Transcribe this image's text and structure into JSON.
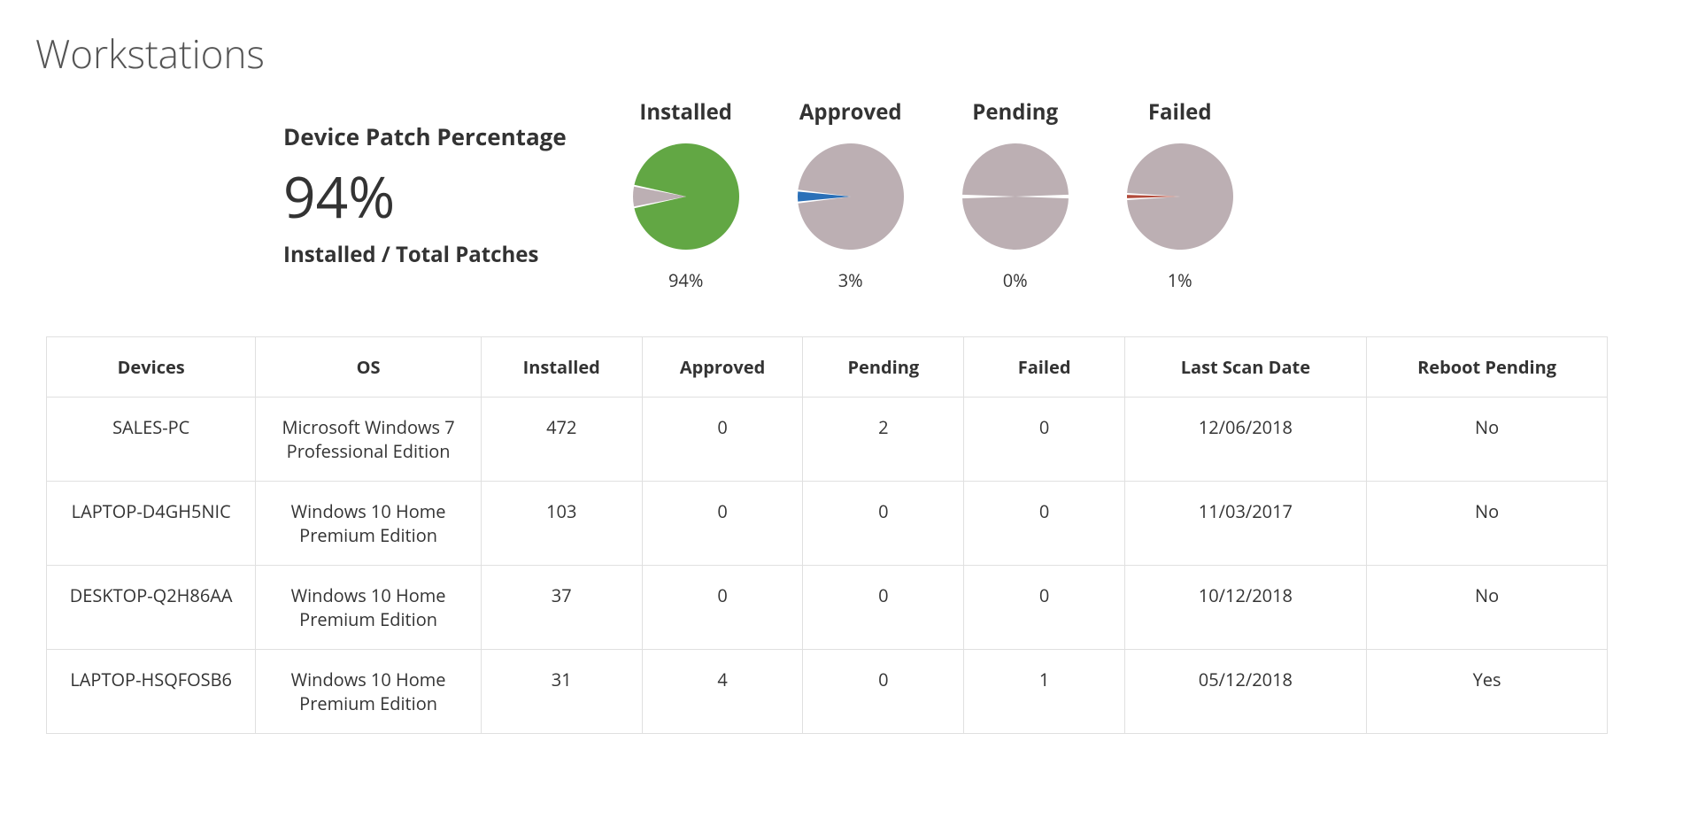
{
  "title": "Workstations",
  "summary": {
    "label": "Device Patch Percentage",
    "value": "94%",
    "sub": "Installed / Total Patches"
  },
  "colors": {
    "installed": "#62a744",
    "approved": "#2a70b8",
    "pending": "#8a7a2a",
    "failed": "#b24a3a",
    "remainder": "#bcafb3"
  },
  "chart_data": [
    {
      "type": "pie",
      "title": "Installed",
      "value_pct": 94,
      "value_label": "94%",
      "slice_color": "#62a744",
      "remainder_color": "#bcafb3"
    },
    {
      "type": "pie",
      "title": "Approved",
      "value_pct": 3,
      "value_label": "3%",
      "slice_color": "#2a70b8",
      "remainder_color": "#bcafb3"
    },
    {
      "type": "pie",
      "title": "Pending",
      "value_pct": 0,
      "value_label": "0%",
      "slice_color": "#8a7a2a",
      "remainder_color": "#bcafb3"
    },
    {
      "type": "pie",
      "title": "Failed",
      "value_pct": 1,
      "value_label": "1%",
      "slice_color": "#b24a3a",
      "remainder_color": "#bcafb3"
    }
  ],
  "table": {
    "headers": [
      "Devices",
      "OS",
      "Installed",
      "Approved",
      "Pending",
      "Failed",
      "Last Scan Date",
      "Reboot Pending"
    ],
    "rows": [
      {
        "device": "SALES-PC",
        "os": "Microsoft Windows 7 Professional Edition",
        "installed": "472",
        "approved": "0",
        "pending": "2",
        "failed": "0",
        "last_scan": "12/06/2018",
        "reboot": "No"
      },
      {
        "device": "LAPTOP-D4GH5NIC",
        "os": "Windows 10 Home Premium Edition",
        "installed": "103",
        "approved": "0",
        "pending": "0",
        "failed": "0",
        "last_scan": "11/03/2017",
        "reboot": "No"
      },
      {
        "device": "DESKTOP-Q2H86AA",
        "os": "Windows 10 Home Premium Edition",
        "installed": "37",
        "approved": "0",
        "pending": "0",
        "failed": "0",
        "last_scan": "10/12/2018",
        "reboot": "No"
      },
      {
        "device": "LAPTOP-HSQFOSB6",
        "os": "Windows 10 Home Premium Edition",
        "installed": "31",
        "approved": "4",
        "pending": "0",
        "failed": "1",
        "last_scan": "05/12/2018",
        "reboot": "Yes"
      }
    ]
  }
}
